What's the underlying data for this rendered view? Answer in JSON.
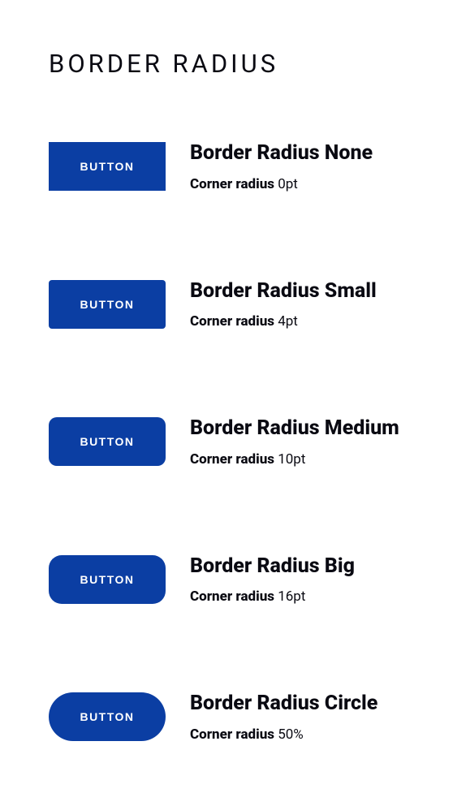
{
  "title": "BORDER RADIUS",
  "rows": [
    {
      "button_label": "BUTTON",
      "title": "Border Radius None",
      "radius_label": "Corner radius",
      "radius_value": "0pt"
    },
    {
      "button_label": "BUTTON",
      "title": "Border Radius Small",
      "radius_label": "Corner radius",
      "radius_value": "4pt"
    },
    {
      "button_label": "BUTTON",
      "title": "Border Radius Medium",
      "radius_label": "Corner radius",
      "radius_value": "10pt"
    },
    {
      "button_label": "BUTTON",
      "title": "Border Radius Big",
      "radius_label": "Corner radius",
      "radius_value": "16pt"
    },
    {
      "button_label": "BUTTON",
      "title": "Border Radius Circle",
      "radius_label": "Corner radius",
      "radius_value": "50%"
    }
  ]
}
